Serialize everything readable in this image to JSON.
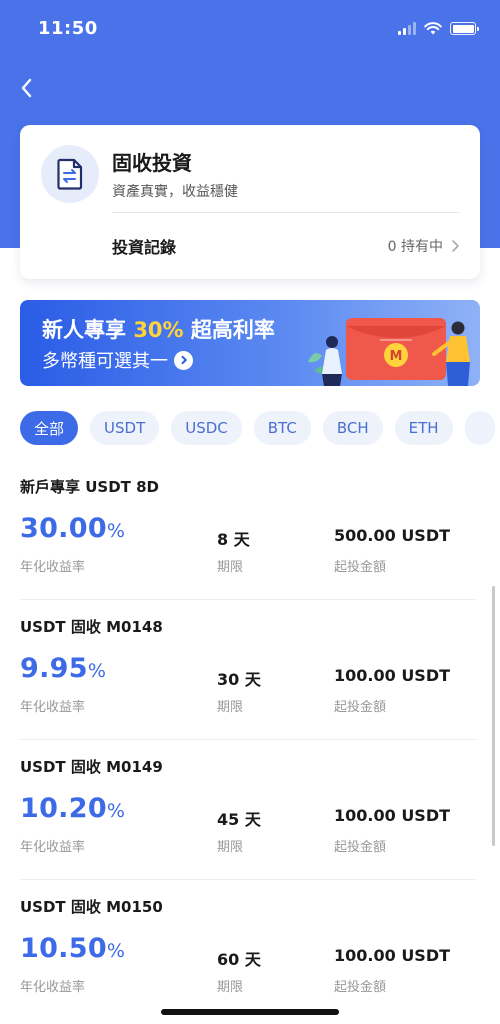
{
  "status_bar": {
    "time": "11:50"
  },
  "summary_card": {
    "icon": "document-exchange-icon",
    "title": "固收投資",
    "subtitle": "資產真實，收益穩健",
    "records_label": "投資記錄",
    "holding_status": "0 持有中"
  },
  "promo_banner": {
    "line1_prefix": "新人專享 ",
    "line1_highlight": "30%",
    "line1_suffix": " 超高利率",
    "line2": "多幣種可選其一",
    "colors": {
      "highlight": "#ffd33c",
      "background": "#2a5ce6"
    }
  },
  "filter_tabs": [
    {
      "label": "全部",
      "active": true
    },
    {
      "label": "USDT",
      "active": false
    },
    {
      "label": "USDC",
      "active": false
    },
    {
      "label": "BTC",
      "active": false
    },
    {
      "label": "BCH",
      "active": false
    },
    {
      "label": "ETH",
      "active": false
    }
  ],
  "products": [
    {
      "name": "新戶專享 USDT 8D",
      "rate": "30.00",
      "rate_unit": "%",
      "rate_label": "年化收益率",
      "term": "8 天",
      "term_label": "期限",
      "min_amount": "500.00 USDT",
      "min_label": "起投金額"
    },
    {
      "name": "USDT 固收 M0148",
      "rate": "9.95",
      "rate_unit": "%",
      "rate_label": "年化收益率",
      "term": "30 天",
      "term_label": "期限",
      "min_amount": "100.00 USDT",
      "min_label": "起投金額"
    },
    {
      "name": "USDT 固收 M0149",
      "rate": "10.20",
      "rate_unit": "%",
      "rate_label": "年化收益率",
      "term": "45 天",
      "term_label": "期限",
      "min_amount": "100.00 USDT",
      "min_label": "起投金額"
    },
    {
      "name": "USDT 固收 M0150",
      "rate": "10.50",
      "rate_unit": "%",
      "rate_label": "年化收益率",
      "term": "60 天",
      "term_label": "期限",
      "min_amount": "100.00 USDT",
      "min_label": "起投金額"
    }
  ],
  "colors": {
    "accent": "#3d6ae6",
    "header_bg": "#4a73ea"
  }
}
